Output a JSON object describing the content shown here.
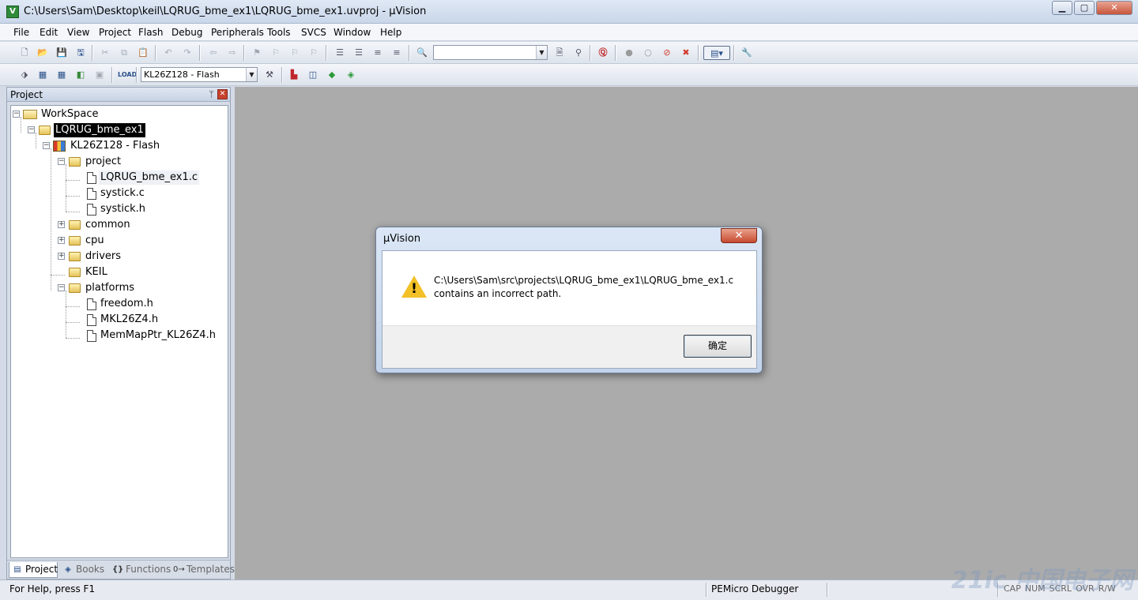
{
  "window": {
    "title": "C:\\Users\\Sam\\Desktop\\keil\\LQRUG_bme_ex1\\LQRUG_bme_ex1.uvproj - µVision",
    "icon": "uvision-icon",
    "minimize_glyph": "▁",
    "maximize_glyph": "▢",
    "close_glyph": "✕"
  },
  "menu": [
    "File",
    "Edit",
    "View",
    "Project",
    "Flash",
    "Debug",
    "Peripherals",
    "Tools",
    "SVCS",
    "Window",
    "Help"
  ],
  "toolbar": {
    "find_combo_value": "",
    "target_combo_value": "KL26Z128 - Flash"
  },
  "project_panel": {
    "title": "Project",
    "pin_glyph": "ᛘ",
    "close_glyph": "✕",
    "tree": [
      {
        "label": "WorkSpace",
        "kind": "workspace",
        "expander": "−"
      },
      {
        "label": "LQRUG_bme_ex1",
        "kind": "folder",
        "expander": "−",
        "selected": true
      },
      {
        "label": "KL26Z128 - Flash",
        "kind": "target",
        "expander": "−"
      },
      {
        "label": "project",
        "kind": "folder",
        "expander": "−"
      },
      {
        "label": "LQRUG_bme_ex1.c",
        "kind": "file",
        "hover": true
      },
      {
        "label": "systick.c",
        "kind": "file"
      },
      {
        "label": "systick.h",
        "kind": "file"
      },
      {
        "label": "common",
        "kind": "folder",
        "expander": "+"
      },
      {
        "label": "cpu",
        "kind": "folder",
        "expander": "+"
      },
      {
        "label": "drivers",
        "kind": "folder",
        "expander": "+"
      },
      {
        "label": "KEIL",
        "kind": "folder"
      },
      {
        "label": "platforms",
        "kind": "folder",
        "expander": "−"
      },
      {
        "label": "freedom.h",
        "kind": "file"
      },
      {
        "label": "MKL26Z4.h",
        "kind": "file"
      },
      {
        "label": "MemMapPtr_KL26Z4.h",
        "kind": "file"
      }
    ],
    "tabs": [
      {
        "label": "Project",
        "icon_glyph": "▤",
        "active": true
      },
      {
        "label": "Books",
        "icon_glyph": "◈"
      },
      {
        "label": "Functions",
        "icon_glyph": "{}"
      },
      {
        "label": "Templates",
        "icon_glyph": "0→"
      }
    ]
  },
  "dialog": {
    "title": "µVision",
    "close_glyph": "✕",
    "warning_glyph": "!",
    "message_line1": "C:\\Users\\Sam\\src\\projects\\LQRUG_bme_ex1\\LQRUG_bme_ex1.c",
    "message_line2": "contains an incorrect path.",
    "ok_label": "确定"
  },
  "status": {
    "help": "For Help, press F1",
    "debugger": "PEMicro Debugger",
    "indicators": [
      "CAP",
      "NUM",
      "SCRL",
      "OVR",
      "R/W"
    ]
  },
  "watermark": "21ic 中国电子网",
  "colors": {
    "mdi_background": "#ababab",
    "selection": "#000000",
    "warning": "#f2c027",
    "close_button": "#c74a30"
  }
}
